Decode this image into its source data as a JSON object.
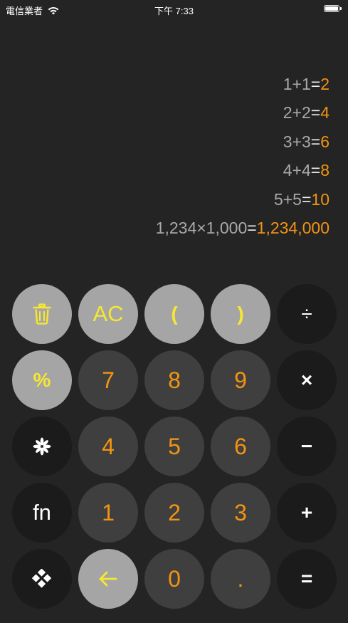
{
  "status_bar": {
    "carrier": "電信業者",
    "time": "下午 7:33"
  },
  "history": [
    {
      "expression": "1+1",
      "equals": "=",
      "result": "2"
    },
    {
      "expression": "2+2",
      "equals": "=",
      "result": "4"
    },
    {
      "expression": "3+3",
      "equals": "=",
      "result": "6"
    },
    {
      "expression": "4+4",
      "equals": "=",
      "result": "8"
    },
    {
      "expression": "5+5",
      "equals": "=",
      "result": "10"
    },
    {
      "expression": "1,234×1,000",
      "equals": "=",
      "result": "1,234,000"
    }
  ],
  "keys": {
    "clear_all": "AC",
    "open_paren": "(",
    "close_paren": ")",
    "divide": "÷",
    "percent": "%",
    "seven": "7",
    "eight": "8",
    "nine": "9",
    "multiply": "×",
    "four": "4",
    "five": "5",
    "six": "6",
    "minus": "−",
    "fn": "fn",
    "one": "1",
    "two": "2",
    "three": "3",
    "plus": "+",
    "zero": "0",
    "decimal": ".",
    "equals": "="
  },
  "icons": {
    "trash": "trash-icon",
    "star": "asterisk-icon",
    "diamond": "four-diamond-icon",
    "backspace": "left-arrow-icon",
    "wifi": "wifi-icon",
    "battery": "battery-icon"
  },
  "colors": {
    "background": "#242424",
    "light_key": "#a5a5a5",
    "mid_key": "#3f3f3f",
    "dark_key": "#1b1b1b",
    "accent_orange": "#f29413",
    "accent_yellow": "#f7e633"
  }
}
